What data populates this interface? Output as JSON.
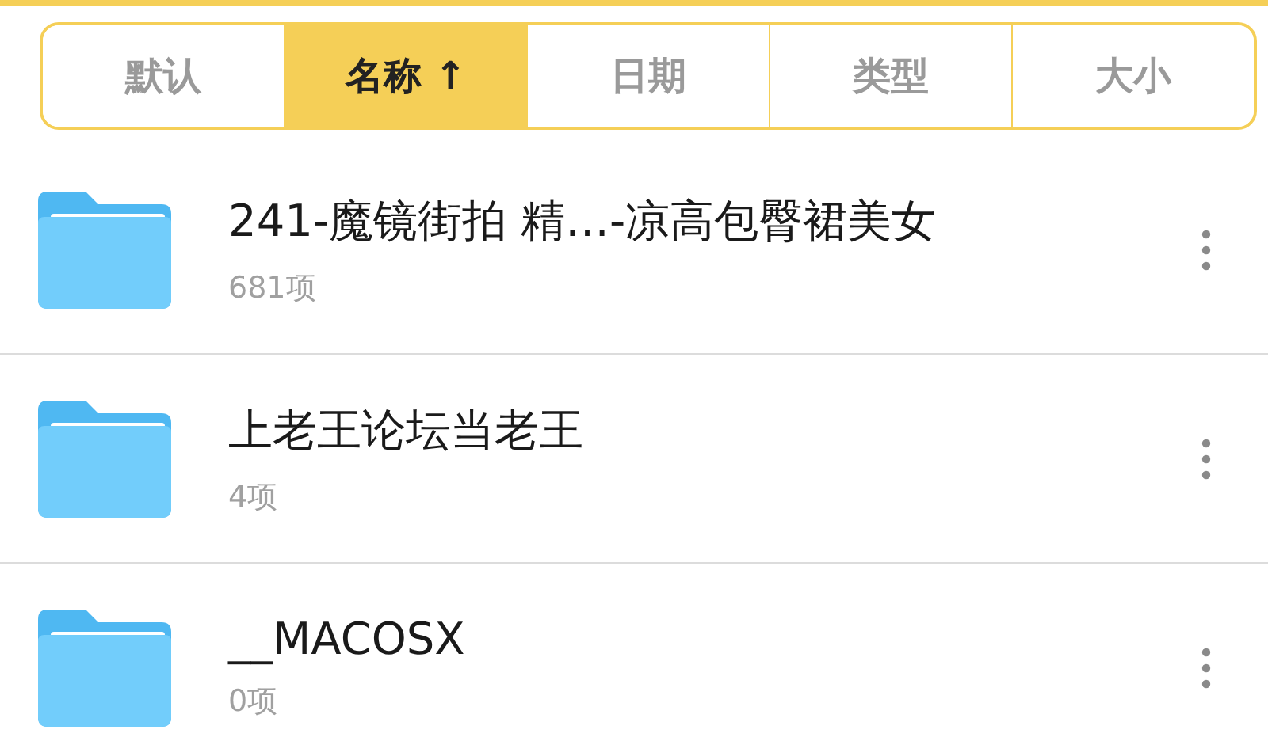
{
  "sort_tabs": [
    {
      "label": "默认",
      "selected": false
    },
    {
      "label": "名称 ↑",
      "selected": true
    },
    {
      "label": "日期",
      "selected": false
    },
    {
      "label": "类型",
      "selected": false
    },
    {
      "label": "大小",
      "selected": false
    }
  ],
  "files": [
    {
      "name": "241-魔镜街拍 精…-凉高包臀裙美女",
      "count": "681项"
    },
    {
      "name": "上老王论坛当老王",
      "count": "4项"
    },
    {
      "name": "__MACOSX",
      "count": "0项"
    }
  ]
}
